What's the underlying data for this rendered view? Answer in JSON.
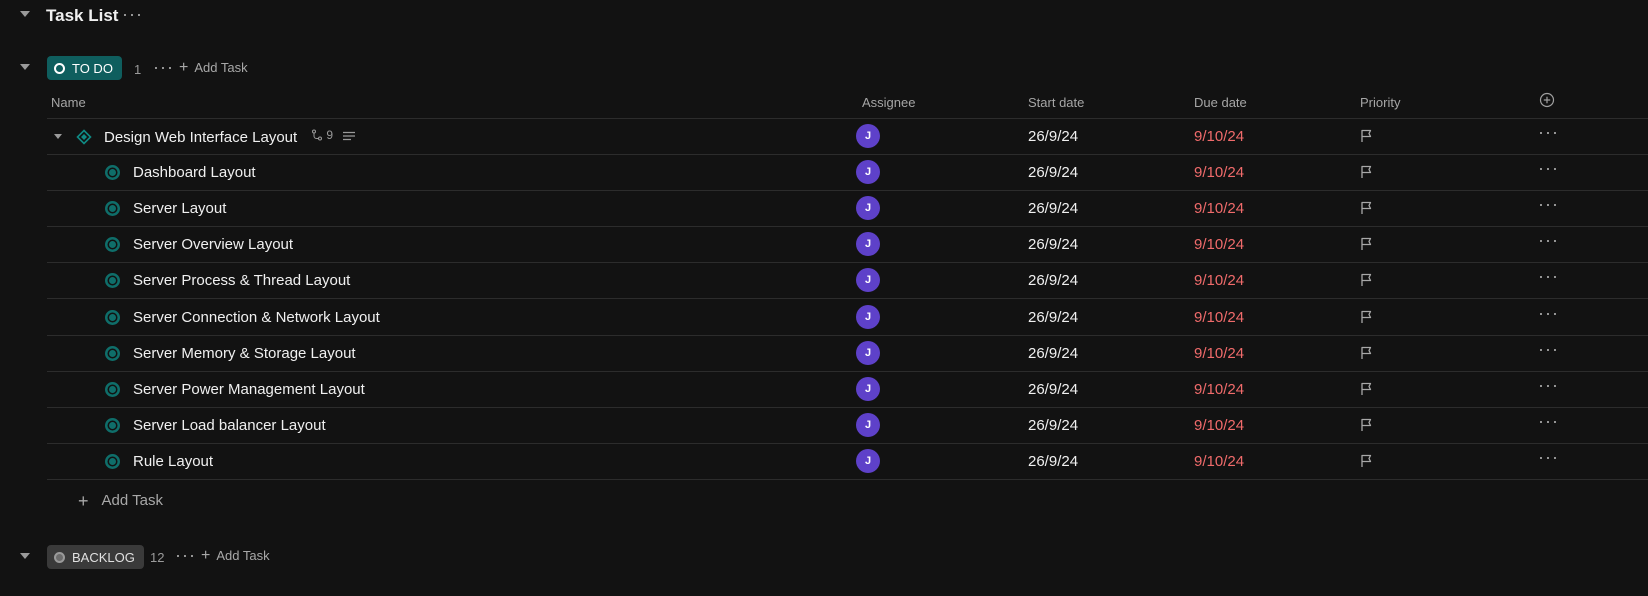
{
  "header": {
    "title": "Task List"
  },
  "todo_group": {
    "status_label": "TO DO",
    "count": "1",
    "add_task_label": "Add Task"
  },
  "columns": {
    "name": "Name",
    "assignee": "Assignee",
    "start_date": "Start date",
    "due_date": "Due date",
    "priority": "Priority"
  },
  "parent_task": {
    "name": "Design Web Interface Layout",
    "subtask_count": "9",
    "assignee_initial": "J",
    "start_date": "26/9/24",
    "due_date": "9/10/24"
  },
  "subtasks": [
    {
      "name": "Dashboard Layout",
      "assignee_initial": "J",
      "start_date": "26/9/24",
      "due_date": "9/10/24"
    },
    {
      "name": "Server Layout",
      "assignee_initial": "J",
      "start_date": "26/9/24",
      "due_date": "9/10/24"
    },
    {
      "name": "Server Overview Layout",
      "assignee_initial": "J",
      "start_date": "26/9/24",
      "due_date": "9/10/24"
    },
    {
      "name": "Server Process & Thread Layout",
      "assignee_initial": "J",
      "start_date": "26/9/24",
      "due_date": "9/10/24"
    },
    {
      "name": "Server Connection & Network Layout",
      "assignee_initial": "J",
      "start_date": "26/9/24",
      "due_date": "9/10/24"
    },
    {
      "name": "Server Memory & Storage Layout",
      "assignee_initial": "J",
      "start_date": "26/9/24",
      "due_date": "9/10/24"
    },
    {
      "name": "Server Power Management Layout",
      "assignee_initial": "J",
      "start_date": "26/9/24",
      "due_date": "9/10/24"
    },
    {
      "name": "Server Load balancer Layout",
      "assignee_initial": "J",
      "start_date": "26/9/24",
      "due_date": "9/10/24"
    },
    {
      "name": "Rule Layout",
      "assignee_initial": "J",
      "start_date": "26/9/24",
      "due_date": "9/10/24"
    }
  ],
  "inline_add_task_label": "Add Task",
  "backlog_group": {
    "status_label": "BACKLOG",
    "count": "12",
    "add_task_label": "Add Task"
  },
  "colors": {
    "background": "#121212",
    "todo_accent": "#0f5e5e",
    "avatar": "#5e41c9",
    "due_date": "#f06b6b"
  }
}
